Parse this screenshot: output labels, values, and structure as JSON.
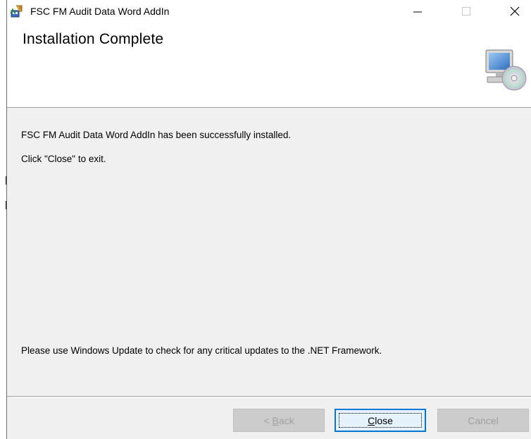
{
  "window": {
    "title": "FSC FM Audit Data Word AddIn",
    "controls": {
      "minimize": "minimize",
      "maximize": "maximize",
      "close": "close"
    }
  },
  "banner": {
    "title": "Installation Complete",
    "icon": "computer-cd-icon"
  },
  "body": {
    "line1": "FSC FM Audit Data Word AddIn has been successfully installed.",
    "line2": "Click \"Close\" to exit.",
    "line3": "Please use Windows Update to check for any critical updates to the .NET Framework."
  },
  "buttons": {
    "back": {
      "mnemonic": "B",
      "rest": "ack",
      "prefix": "< "
    },
    "close": {
      "mnemonic": "C",
      "rest": "lose"
    },
    "cancel": {
      "label": "Cancel"
    }
  },
  "colors": {
    "accent": "#0078d7",
    "disabled_text": "#a0a0a0",
    "dialog_bg": "#f0f0f0"
  }
}
